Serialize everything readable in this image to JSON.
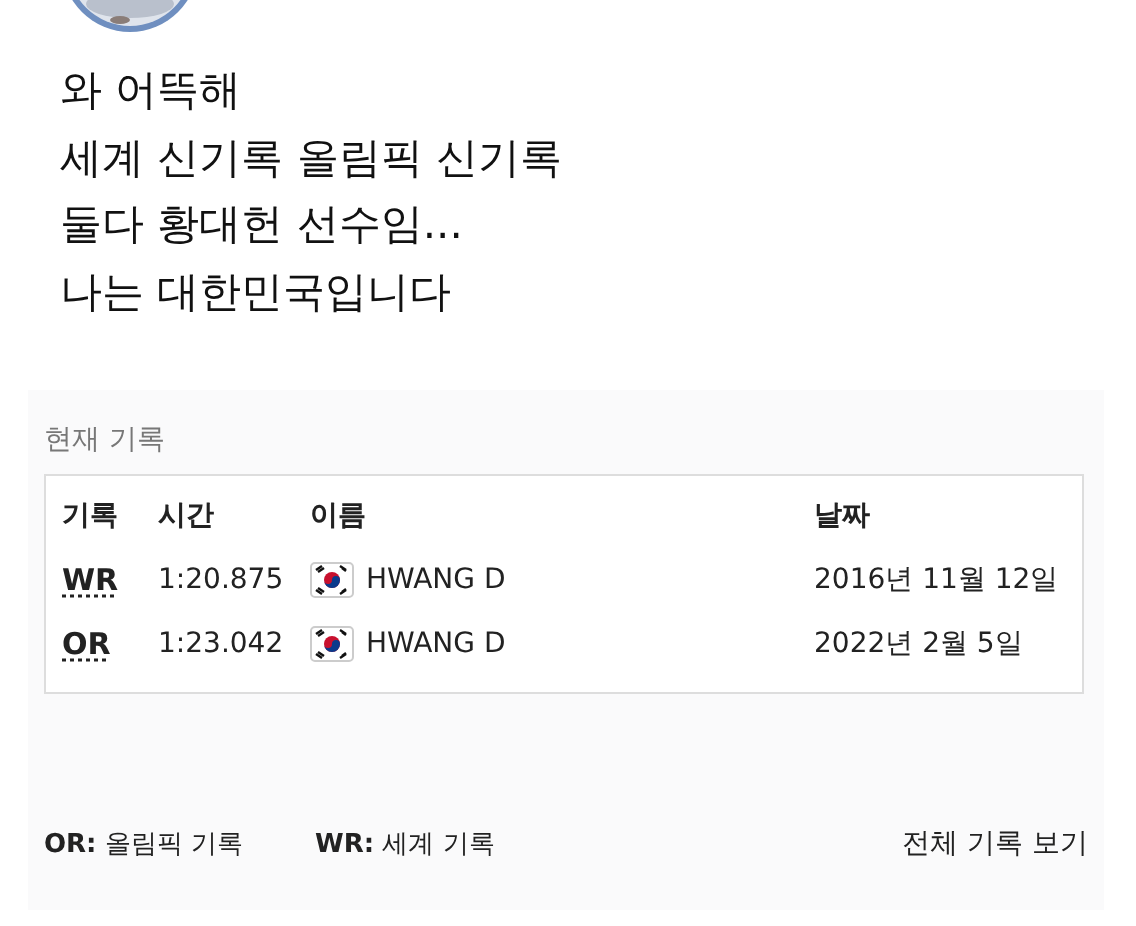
{
  "post": {
    "lines": [
      "와 어뜩해",
      "세계 신기록 올림픽 신기록",
      "둘다 황대헌 선수임...",
      "나는 대한민국입니다"
    ]
  },
  "records": {
    "title": "현재 기록",
    "columns": [
      "기록",
      "시간",
      "이름",
      "날짜"
    ],
    "rows": [
      {
        "record": "WR",
        "time": "1:20.875",
        "name": "HWANG D",
        "date": "2016년 11월 12일"
      },
      {
        "record": "OR",
        "time": "1:23.042",
        "name": "HWANG D",
        "date": "2022년 2월 5일"
      }
    ],
    "legend": [
      "**OR:** 올림픽 기록",
      "**WR:** 세계 기록"
    ],
    "link": "전체 기록 보기"
  }
}
